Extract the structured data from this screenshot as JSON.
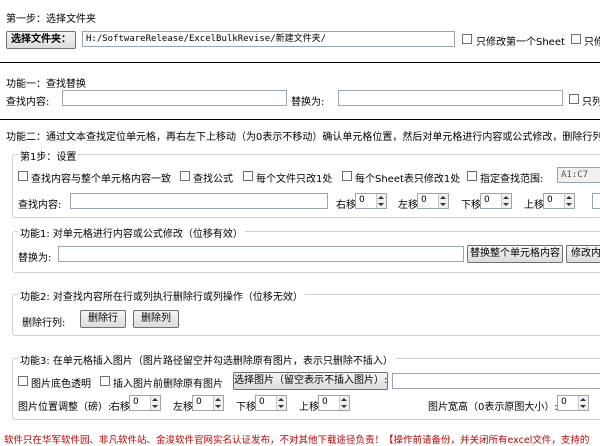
{
  "step1": {
    "title": "第一步：选择文件夹",
    "select_folder_button": "选择文件夹：",
    "folder_path": "H:/SoftwareRelease/ExcelBulkRevise/新建文件夹/",
    "only_first_sheet_label": "只修改第一个Sheet",
    "only_label": "只修"
  },
  "feature1": {
    "title": "功能一：查找替换",
    "find_label": "查找内容:",
    "find_value": "",
    "replace_label": "替换为:",
    "replace_value": "",
    "only_label": "只列"
  },
  "feature2": {
    "title": "功能二：通过文本查找定位单元格，再右左下上移动（为0表示不移动）确认单元格位置，然后对单元格进行内容或公式修改，删除行列，插",
    "step1": {
      "title": "第1步：设置",
      "cb_match_whole": "查找内容与整个单元格内容一致",
      "cb_find_formula": "查找公式",
      "cb_one_per_file": "每个文件只改1处",
      "cb_one_per_sheet": "每个Sheet表只修改1处",
      "cb_range": "指定查找范围:",
      "range_value": "A1:C7",
      "find_label": "查找内容:",
      "find_value": "",
      "right_label": "右移",
      "right_value": "0",
      "left_label": "左移",
      "left_value": "0",
      "down_label": "下移",
      "down_value": "0",
      "up_label": "上移",
      "up_value": "0"
    },
    "func1": {
      "title": "功能1: 对单元格进行内容或公式修改（位移有效）",
      "replace_label": "替换为:",
      "replace_value": "",
      "replace_whole_button": "替换整个单元格内容",
      "modify_button": "修改内"
    },
    "func2": {
      "title": "功能2: 对查找内容所在行或列执行删除行或列操作（位移无效）",
      "delete_label": "删除行列:",
      "delete_row_button": "删除行",
      "delete_col_button": "删除列"
    },
    "func3": {
      "title": "功能3: 在单元格插入图片（图片路径留空并勾选删除原有图片，表示只删除不插入）",
      "cb_transparent": "图片底色透明",
      "cb_delete_existing": "插入图片前删除原有图片",
      "select_image_button": "选择图片（留空表示不插入图片）:",
      "image_path": "",
      "pos_label": "图片位置调整（磅）:",
      "right_label": "右移",
      "right_value": "0",
      "left_label": "左移",
      "left_value": "0",
      "down_label": "下移",
      "down_value": "0",
      "up_label": "上移",
      "up_value": "0",
      "width_label": "图片宽高（0表示原图大小）:",
      "width_value": "0"
    }
  },
  "footer": {
    "notice": "软件只在华军软件园、非凡软件站、金浚软件官网实名认证发布，不对其他下载途径负责！【操作前请备份，并关闭所有excel文件，支持的"
  }
}
